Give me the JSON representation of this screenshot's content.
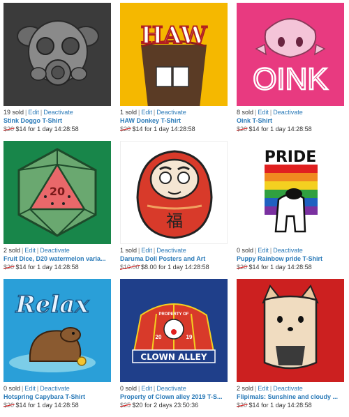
{
  "products": [
    {
      "sold": "19 sold",
      "edit": "Edit",
      "deactivate": "Deactivate",
      "title": "Stink Doggo T-Shirt",
      "old_price": "$20",
      "price": "$14 for 1 day 14:28:58",
      "bg": "#3a3a3a",
      "art": "gasmask-dog"
    },
    {
      "sold": "1 sold",
      "edit": "Edit",
      "deactivate": "Deactivate",
      "title": "HAW Donkey T-Shirt",
      "old_price": "$20",
      "price": "$14 for 1 day 14:28:58",
      "bg": "#f5b800",
      "art": "haw-donkey",
      "art_text": "HAW"
    },
    {
      "sold": "8 sold",
      "edit": "Edit",
      "deactivate": "Deactivate",
      "title": "Oink T-Shirt",
      "old_price": "$20",
      "price": "$14 for 1 day 14:28:58",
      "bg": "#e83a80",
      "art": "oink-pig",
      "art_text": "OINK"
    },
    {
      "sold": "2 sold",
      "edit": "Edit",
      "deactivate": "Deactivate",
      "title": "Fruit Dice, D20 watermelon varia...",
      "old_price": "$20",
      "price": "$14 for 1 day 14:28:58",
      "bg": "#18864a",
      "art": "d20-watermelon",
      "art_text": "20"
    },
    {
      "sold": "1 sold",
      "edit": "Edit",
      "deactivate": "Deactivate",
      "title": "Daruma Doll Posters and Art",
      "old_price": "$10.00",
      "price": "$8.00 for 1 day 14:28:58",
      "bg": "#ffffff",
      "art": "daruma-doll",
      "art_text": "福"
    },
    {
      "sold": "0 sold",
      "edit": "Edit",
      "deactivate": "Deactivate",
      "title": "Puppy Rainbow pride T-Shirt",
      "old_price": "$20",
      "price": "$14 for 1 day 14:28:58",
      "bg": "#ffffff",
      "art": "pride-puppy",
      "art_text": "PRIDE"
    },
    {
      "sold": "0 sold",
      "edit": "Edit",
      "deactivate": "Deactivate",
      "title": "Hotspring Capybara T-Shirt",
      "old_price": "$20",
      "price": "$14 for 1 day 14:28:58",
      "bg": "#2a9fd8",
      "art": "relax-capybara",
      "art_text": "Relax"
    },
    {
      "sold": "0 sold",
      "edit": "Edit",
      "deactivate": "Deactivate",
      "title": "Property of Clown alley 2019 T-S...",
      "old_price": "$25",
      "price": "$20 for 2 days 23:50:36",
      "bg": "#1f3f8a",
      "art": "clown-alley",
      "art_text": "CLOWN ALLEY",
      "art_text_2": "PROPERTY OF",
      "art_text_3": "20",
      "art_text_4": "19"
    },
    {
      "sold": "2 sold",
      "edit": "Edit",
      "deactivate": "Deactivate",
      "title": "Flipimals: Sunshine and cloudy ...",
      "old_price": "$20",
      "price": "$14 for 1 day 14:28:58",
      "bg": "#cc2020",
      "art": "flip-shiba"
    }
  ]
}
